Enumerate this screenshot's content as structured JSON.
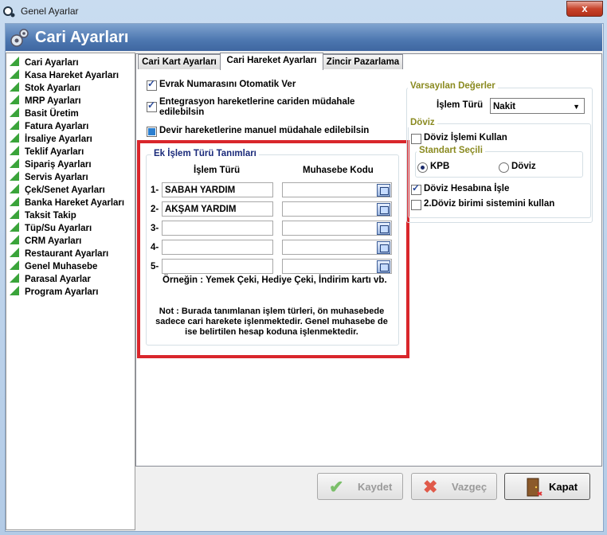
{
  "window": {
    "title": "Genel Ayarlar",
    "close_label": "x"
  },
  "header": {
    "title": "Cari Ayarları"
  },
  "sidebar": {
    "items": [
      "Cari Ayarları",
      "Kasa Hareket Ayarları",
      "Stok Ayarları",
      "MRP Ayarları",
      "Basit Üretim",
      "Fatura Ayarları",
      "İrsaliye Ayarları",
      "Teklif Ayarları",
      "Sipariş Ayarları",
      "Servis Ayarları",
      "Çek/Senet Ayarları",
      "Banka Hareket Ayarları",
      "Taksit Takip",
      "Tüp/Su Ayarları",
      "CRM Ayarları",
      "Restaurant Ayarları",
      "Genel Muhasebe",
      "Parasal Ayarlar",
      "Program Ayarları"
    ]
  },
  "tabs": [
    "Cari Kart Ayarları",
    "Cari Hareket Ayarları",
    "Zincir Pazarlama"
  ],
  "active_tab": 1,
  "options": {
    "evrak": "Evrak Numarasını Otomatik Ver",
    "entegrasyon": "Entegrasyon hareketlerine cariden müdahale edilebilsin",
    "devir": "Devir hareketlerine manuel müdahale edilebilsin"
  },
  "ek_islem": {
    "legend": "Ek İşlem Türü Tanımları",
    "col_islem": "İşlem Türü",
    "col_muhasebe": "Muhasebe Kodu",
    "rows": [
      {
        "no": "1-",
        "islem": "SABAH YARDIM",
        "kod": ""
      },
      {
        "no": "2-",
        "islem": "AKŞAM YARDIM",
        "kod": ""
      },
      {
        "no": "3-",
        "islem": "",
        "kod": ""
      },
      {
        "no": "4-",
        "islem": "",
        "kod": ""
      },
      {
        "no": "5-",
        "islem": "",
        "kod": ""
      }
    ],
    "example": "Örneğin : Yemek Çeki, Hediye Çeki, İndirim kartı vb.",
    "note": "Not : Burada tanımlanan işlem türleri, ön muhasebede sadece cari harekete işlenmektedir. Genel muhasebe de ise belirtilen hesap koduna işlenmektedir."
  },
  "varsayilan": {
    "legend": "Varsayılan Değerler",
    "islem_turu_label": "İşlem Türü",
    "islem_turu_value": "Nakit"
  },
  "doviz": {
    "legend": "Döviz",
    "islemi_kullan": "Döviz İşlemi Kullan",
    "standart_legend": "Standart Seçili",
    "kpb": "KPB",
    "doviz": "Döviz",
    "hesabina_isle": "Döviz Hesabına İşle",
    "ikinci_doviz": "2.Döviz birimi sistemini kullan"
  },
  "buttons": {
    "kaydet": "Kaydet",
    "vazgec": "Vazgeç",
    "kapat": "Kapat"
  }
}
